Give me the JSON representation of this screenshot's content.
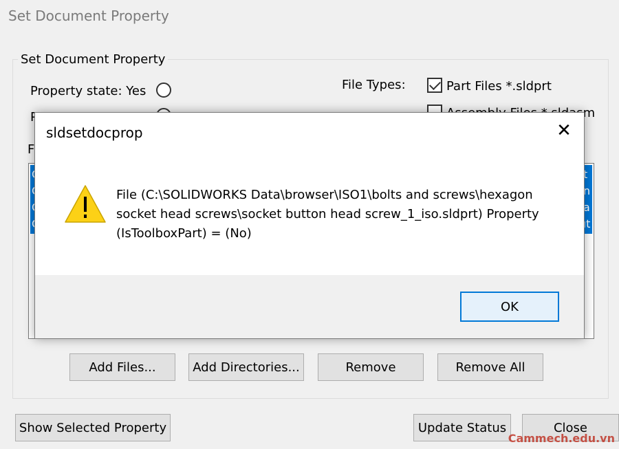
{
  "window": {
    "title": "Set Document Property"
  },
  "group": {
    "legend": "Set Document Property"
  },
  "property_state": {
    "yes_label": "Property state: Yes",
    "no_label_partial": "P",
    "yes_checked": false,
    "no_checked": true
  },
  "file_types": {
    "label": "File Types:",
    "part_files": "Part Files *.sldprt",
    "part_checked": true,
    "assembly_files_partial": "Assembly Files *.sldasm",
    "assembly_checked": false
  },
  "list": {
    "label_partial": "Fi",
    "rows_left": [
      "C",
      "C",
      "C",
      "C"
    ],
    "rows_right": [
      "t",
      "n",
      "a",
      "ut"
    ]
  },
  "buttons": {
    "add_files": "Add Files...",
    "add_directories": "Add Directories...",
    "remove": "Remove",
    "remove_all": "Remove All",
    "show_selected_property": "Show Selected Property",
    "update_status": "Update Status",
    "close": "Close"
  },
  "dialog": {
    "title": "sldsetdocprop",
    "close_glyph": "✕",
    "message": "File (C:\\SOLIDWORKS Data\\browser\\ISO1\\bolts and screws\\hexagon socket head screws\\socket button head screw_1_iso.sldprt) Property (IsToolboxPart) = (No)",
    "ok_label": "OK",
    "icon": "warning-icon"
  },
  "watermark": "Cammech.edu.vn",
  "colors": {
    "selection": "#0078d7",
    "warning_yellow": "#fcd116",
    "default_button_border": "#0078d7"
  }
}
